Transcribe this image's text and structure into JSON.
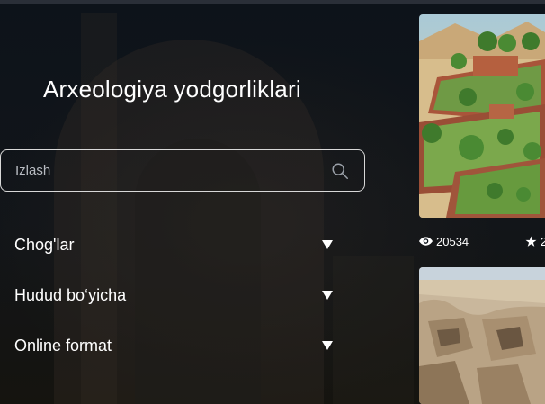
{
  "page": {
    "title": "Arxeologiya yodgorliklari"
  },
  "search": {
    "placeholder": "Izlash",
    "icon": "search-icon"
  },
  "filters": [
    {
      "label": "Chog'lar",
      "icon": "caret-down-icon"
    },
    {
      "label": "Hudud bo‘yicha",
      "icon": "caret-down-icon"
    },
    {
      "label": "Online format",
      "icon": "caret-down-icon"
    }
  ],
  "cards": [
    {
      "image": "terraced-garden-ruins-illustration",
      "views": "20534",
      "rating": "2",
      "view_icon": "eye-icon",
      "rating_icon": "star-icon"
    },
    {
      "image": "excavated-stone-ruins-photo"
    }
  ],
  "colors": {
    "background": "#0c1219",
    "text": "#ffffff",
    "border": "#d8d8d8"
  }
}
